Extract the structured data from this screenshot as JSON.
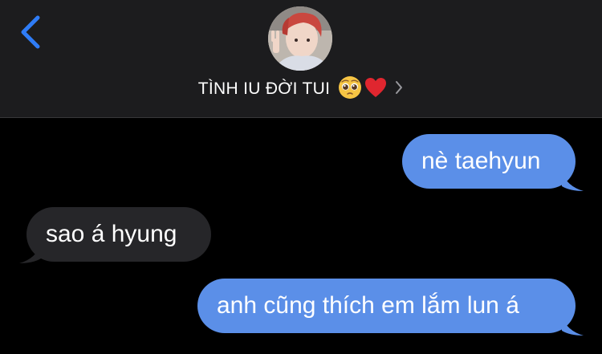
{
  "header": {
    "contact_name": "TÌNH IU ĐỜI TUI",
    "emoji_pleading": "pleading-face-emoji",
    "emoji_heart": "red-heart-emoji",
    "back_icon": "chevron-left-icon",
    "detail_icon": "chevron-right-icon"
  },
  "messages": [
    {
      "direction": "sent",
      "text": "nè taehyun"
    },
    {
      "direction": "received",
      "text": "sao á hyung"
    },
    {
      "direction": "sent",
      "text": "anh cũng thích em lắm lun á"
    }
  ],
  "colors": {
    "background": "#000000",
    "header": "#1c1c1e",
    "sent_bubble": "#5b8fe8",
    "received_bubble": "#262629",
    "accent": "#2f7cf6"
  }
}
